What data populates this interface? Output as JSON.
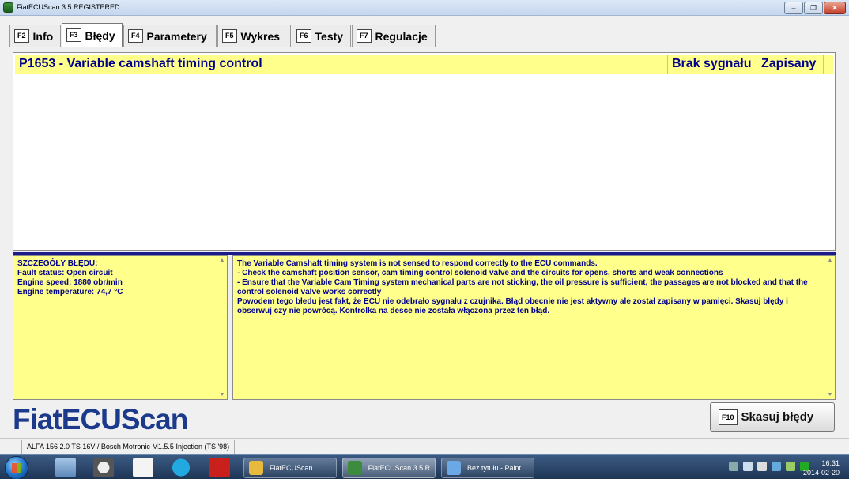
{
  "window": {
    "title": "FiatECUScan 3.5 REGISTERED",
    "buttons": {
      "minimize": "–",
      "maximize": "❐",
      "close": "✕"
    }
  },
  "tabs": [
    {
      "key": "F2",
      "label": "Info",
      "active": false
    },
    {
      "key": "F3",
      "label": "Błędy",
      "active": true
    },
    {
      "key": "F4",
      "label": "Parametery",
      "active": false
    },
    {
      "key": "F5",
      "label": "Wykres",
      "active": false
    },
    {
      "key": "F6",
      "label": "Testy",
      "active": false
    },
    {
      "key": "F7",
      "label": "Regulacje",
      "active": false
    }
  ],
  "fault_list": {
    "rows": [
      {
        "code_description": "P1653 - Variable camshaft timing control",
        "signal": "Brak sygnału",
        "status": "Zapisany"
      }
    ]
  },
  "details_left": {
    "header": "SZCZEGÓŁY BŁĘDU:",
    "lines": [
      "Fault status: Open circuit",
      "Engine speed: 1880 obr/min",
      "Engine temperature: 74,7 °C"
    ]
  },
  "details_right": {
    "lines": [
      "The Variable Camshaft timing system is not sensed to respond correctly to the ECU commands.",
      "- Check the camshaft position sensor, cam timing control solenoid valve and the circuits for opens, shorts and weak connections",
      "- Ensure that the Variable Cam Timing system mechanical parts are not sticking, the oil pressure is sufficient, the passages are not blocked and that the control solenoid valve works correctly",
      "Powodem tego błedu jest fakt, że ECU nie odebrało sygnału z czujnika. Błąd obecnie nie jest aktywny ale został zapisany w pamięci. Skasuj błędy i obserwuj czy nie powrócą. Kontrolka na desce nie została włączona przez ten błąd."
    ]
  },
  "brand": "FiatECUScan",
  "clear_button": {
    "key": "F10",
    "label": "Skasuj błędy"
  },
  "statusbar": {
    "vehicle": "ALFA 156 2.0 TS 16V / Bosch Motronic M1.5.5 Injection (TS '98)"
  },
  "taskbar": {
    "tasks": [
      {
        "label": "FiatECUScan",
        "icon": "folder-icon",
        "color": "#e7b93c",
        "active": false
      },
      {
        "label": "FiatECUScan 3.5 R...",
        "icon": "fiatecuscan-icon",
        "color": "#3d8b3d",
        "active": true
      },
      {
        "label": "Bez tytułu - Paint",
        "icon": "paint-icon",
        "color": "#6aa9e6",
        "active": false
      }
    ],
    "clock": {
      "time": "16:31",
      "date": "2014-02-20"
    }
  },
  "colors": {
    "panel_yellow": "#ffff8c",
    "text_blue": "#00008b",
    "brand_blue": "#1c3a8c",
    "separator": "#1a1a8c"
  }
}
